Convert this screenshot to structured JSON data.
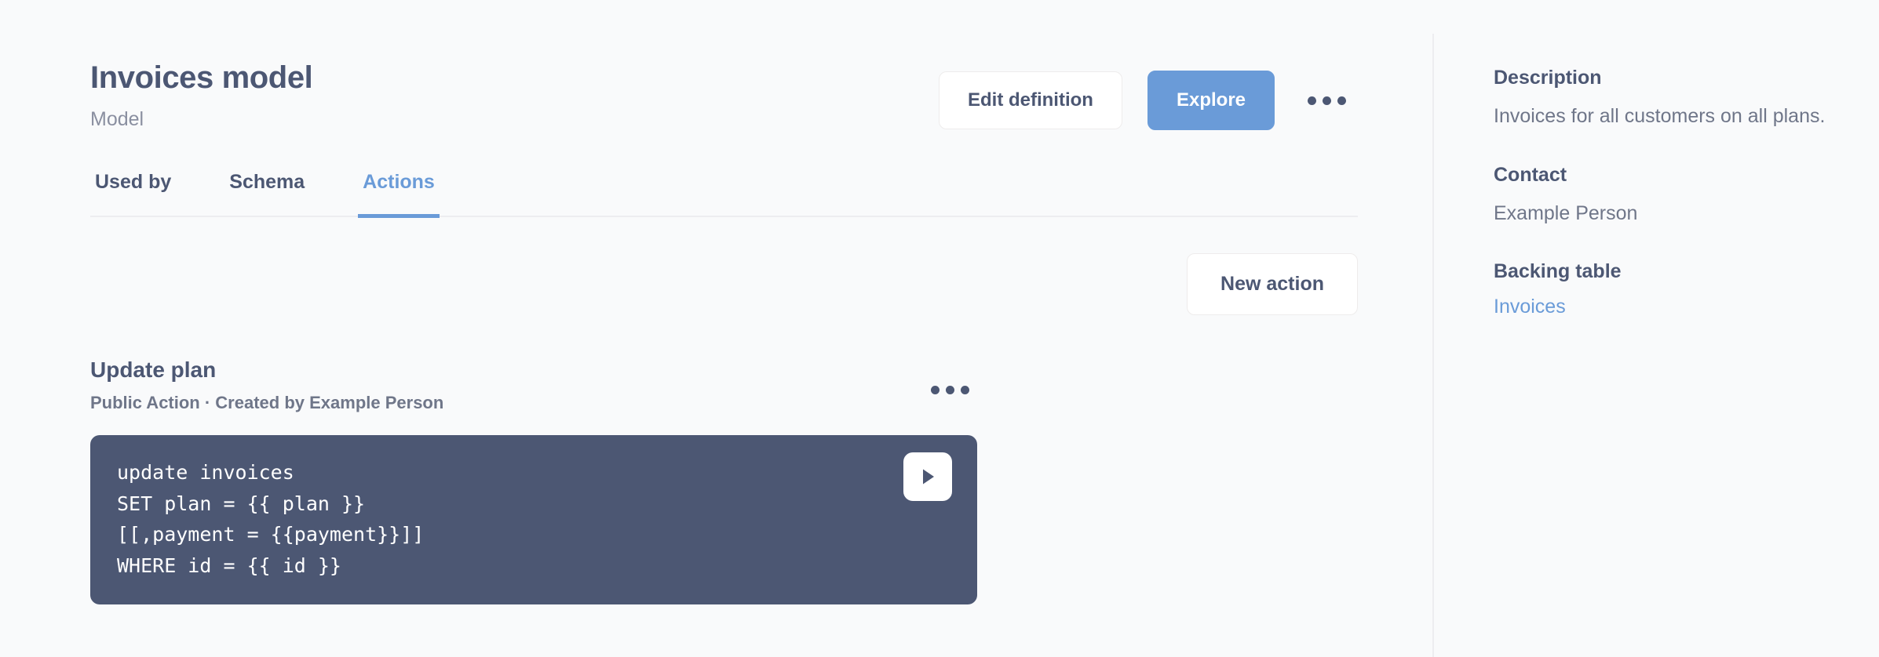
{
  "header": {
    "title": "Invoices model",
    "subtitle": "Model",
    "edit_label": "Edit definition",
    "explore_label": "Explore"
  },
  "tabs": [
    {
      "label": "Used by",
      "active": false
    },
    {
      "label": "Schema",
      "active": false
    },
    {
      "label": "Actions",
      "active": true
    }
  ],
  "actions_panel": {
    "new_action_label": "New action",
    "action": {
      "title": "Update plan",
      "meta": "Public Action  ·  Created by Example Person",
      "code": "update invoices\nSET plan = {{ plan }}\n[[,payment = {{payment}}]]\nWHERE id = {{ id }}"
    }
  },
  "sidebar": {
    "description_heading": "Description",
    "description_text": "Invoices for all customers on all plans.",
    "contact_heading": "Contact",
    "contact_name": "Example Person",
    "backing_table_heading": "Backing table",
    "backing_table_name": "Invoices"
  },
  "colors": {
    "accent": "#6a9bd8",
    "text": "#4c5773",
    "muted": "#6f7689",
    "code_bg": "#4c5773",
    "page_bg": "#f9fafb"
  }
}
